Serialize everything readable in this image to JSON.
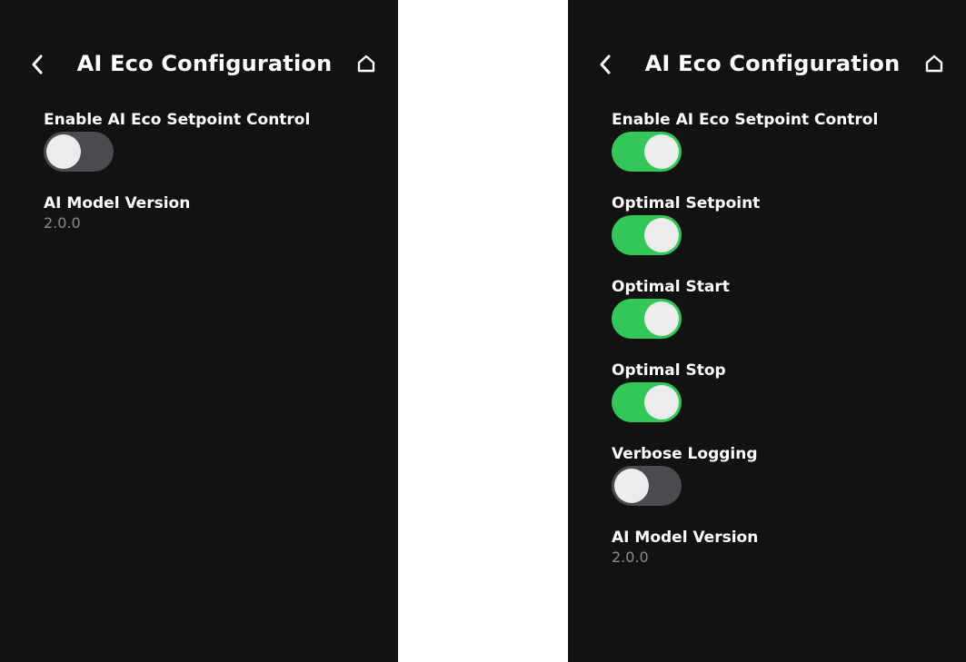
{
  "screens": [
    {
      "header": {
        "title": "AI Eco Configuration",
        "back_icon": "chevron-left-icon",
        "home_icon": "home-icon"
      },
      "settings": [
        {
          "label": "Enable AI Eco Setpoint Control",
          "on": false
        }
      ],
      "model_version": {
        "label": "AI Model Version",
        "value": "2.0.0"
      }
    },
    {
      "header": {
        "title": "AI Eco Configuration",
        "back_icon": "chevron-left-icon",
        "home_icon": "home-icon"
      },
      "settings": [
        {
          "label": "Enable AI Eco Setpoint Control",
          "on": true
        },
        {
          "label": "Optimal Setpoint",
          "on": true
        },
        {
          "label": "Optimal Start",
          "on": true
        },
        {
          "label": "Optimal Stop",
          "on": true
        },
        {
          "label": "Verbose Logging",
          "on": false
        }
      ],
      "model_version": {
        "label": "AI Model Version",
        "value": "2.0.0"
      }
    }
  ],
  "colors": {
    "background": "#121212",
    "toggle_on": "#33c759",
    "toggle_off": "#4a4a4f",
    "knob": "#ececec",
    "secondary_text": "#8a8a8a"
  }
}
